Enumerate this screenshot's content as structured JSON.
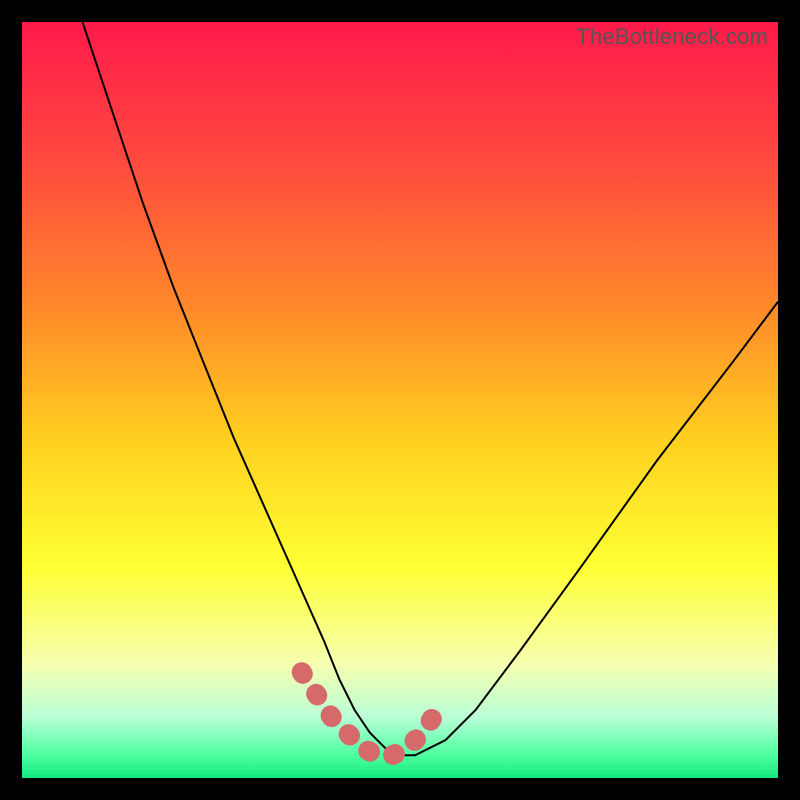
{
  "watermark": "TheBottleneck.com",
  "chart_data": {
    "type": "line",
    "title": "",
    "xlabel": "",
    "ylabel": "",
    "xlim": [
      0,
      100
    ],
    "ylim": [
      0,
      100
    ],
    "series": [
      {
        "name": "curve",
        "x": [
          8,
          12,
          16,
          20,
          24,
          28,
          32,
          36,
          40,
          42,
          44,
          46,
          48,
          50,
          52,
          56,
          60,
          66,
          74,
          84,
          94,
          100
        ],
        "values": [
          100,
          88,
          76,
          65,
          55,
          45,
          36,
          27,
          18,
          13,
          9,
          6,
          4,
          3,
          3,
          5,
          9,
          17,
          28,
          42,
          55,
          63
        ]
      }
    ],
    "highlight": {
      "x": [
        37,
        39,
        41,
        43,
        45,
        47,
        49,
        51,
        53,
        55
      ],
      "values": [
        14,
        11,
        8,
        6,
        4,
        3,
        3,
        4,
        6,
        9
      ]
    },
    "gradient_stops": [
      {
        "offset": 0.0,
        "color": "#ff1a4a"
      },
      {
        "offset": 0.18,
        "color": "#ff483f"
      },
      {
        "offset": 0.38,
        "color": "#ff8a2a"
      },
      {
        "offset": 0.55,
        "color": "#ffcf1f"
      },
      {
        "offset": 0.72,
        "color": "#ffff33"
      },
      {
        "offset": 0.85,
        "color": "#f5ffb0"
      },
      {
        "offset": 0.92,
        "color": "#b8ffd6"
      },
      {
        "offset": 0.97,
        "color": "#4dffa0"
      },
      {
        "offset": 1.0,
        "color": "#12e880"
      }
    ],
    "highlight_color": "#d66a6a"
  }
}
